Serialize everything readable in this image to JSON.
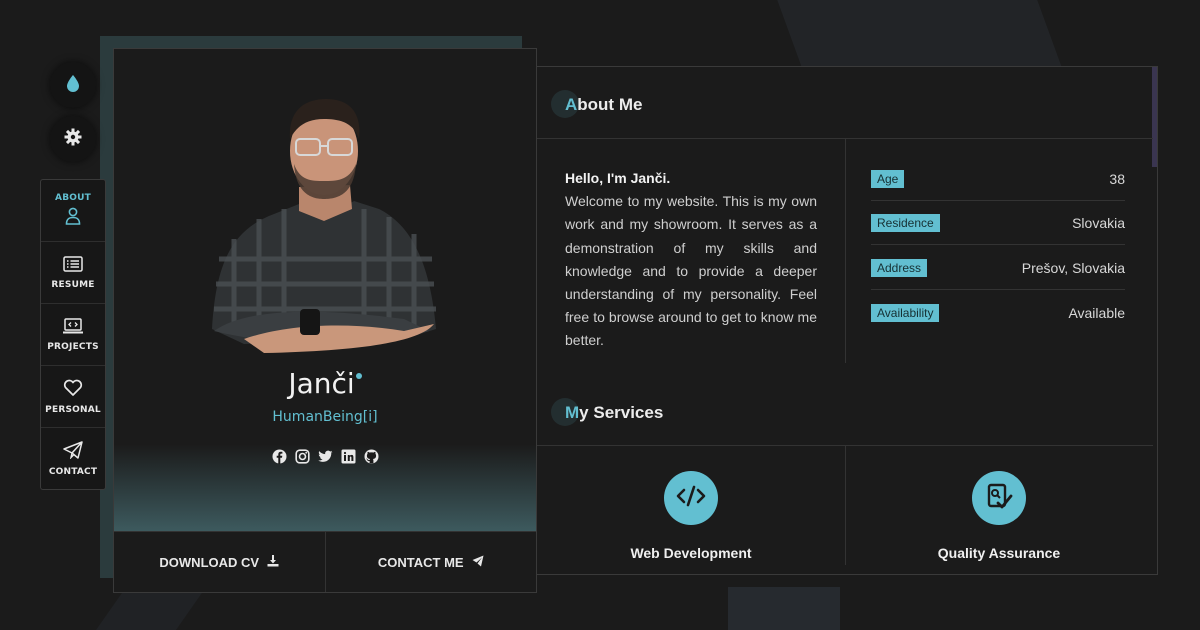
{
  "colors": {
    "accent": "#62bfd1",
    "background": "#1b1b1b"
  },
  "side_buttons": [
    {
      "icon": "droplet-icon"
    },
    {
      "icon": "gear-icon"
    }
  ],
  "nav": {
    "items": [
      {
        "label": "ABOUT",
        "icon": "user-icon",
        "active": true
      },
      {
        "label": "RESUME",
        "icon": "list-icon"
      },
      {
        "label": "PROJECTS",
        "icon": "laptop-code-icon"
      },
      {
        "label": "PERSONAL",
        "icon": "heart-icon"
      },
      {
        "label": "CONTACT",
        "icon": "paper-plane-icon"
      }
    ]
  },
  "profile": {
    "name": "Janči",
    "tagline": "HumanBeing[i]",
    "socials": [
      "facebook-icon",
      "instagram-icon",
      "twitter-icon",
      "linkedin-icon",
      "github-icon"
    ],
    "download_label": "DOWNLOAD CV",
    "contact_label": "CONTACT ME"
  },
  "about": {
    "title_first": "A",
    "title_rest": "bout Me",
    "hello": "Hello, I'm Janči.",
    "text": "Welcome to my website. This is my own work and my showroom. It serves as a demonstration of my skills and knowledge and to provide a deeper understanding of my personality. Feel free to browse around to get to know me better.",
    "info": [
      {
        "label": "Age",
        "value": "38"
      },
      {
        "label": "Residence",
        "value": "Slovakia"
      },
      {
        "label": "Address",
        "value": "Prešov, Slovakia"
      },
      {
        "label": "Availability",
        "value": "Available"
      }
    ]
  },
  "services": {
    "title_first": "M",
    "title_rest": "y Services",
    "items": [
      {
        "name": "Web Development",
        "icon": "code-icon"
      },
      {
        "name": "Quality Assurance",
        "icon": "checklist-icon"
      }
    ]
  }
}
